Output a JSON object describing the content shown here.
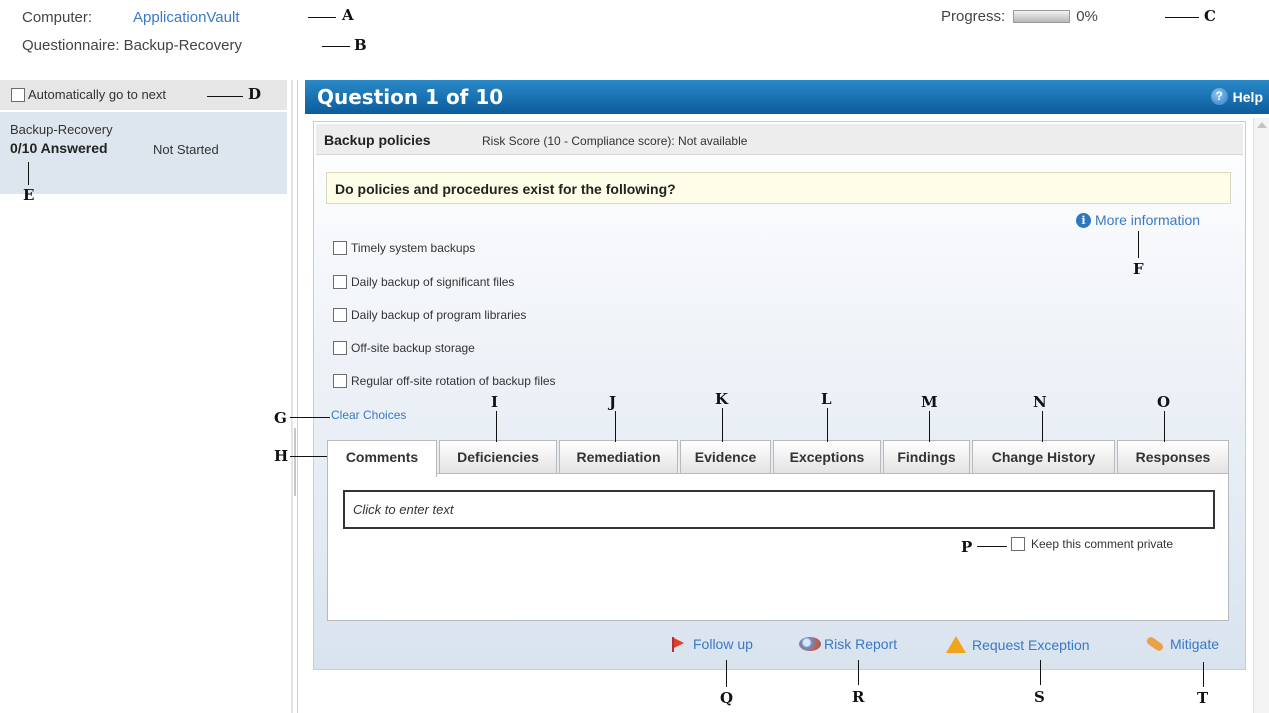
{
  "header": {
    "computer_label": "Computer:",
    "computer_value": "ApplicationVault",
    "questionnaire_label": "Questionnaire:",
    "questionnaire_value": "Backup-Recovery",
    "progress_label": "Progress:",
    "progress_value": "0%"
  },
  "sidebar": {
    "auto_next_label": "Automatically go to next",
    "item": {
      "name": "Backup-Recovery",
      "answered": "0/10 Answered",
      "status": "Not Started"
    }
  },
  "question_panel": {
    "title": "Question 1 of 10",
    "help_label": "Help",
    "topic": "Backup policies",
    "risk_score": "Risk Score (10 - Compliance score): Not available",
    "question_text": "Do policies and procedures exist for the following?",
    "more_info_label": "More information",
    "choices": [
      "Timely system backups",
      "Daily backup of significant files",
      "Daily backup of program libraries",
      "Off-site backup storage",
      "Regular off-site rotation of backup files"
    ],
    "clear_choices_label": "Clear Choices",
    "tabs": [
      "Comments",
      "Deficiencies",
      "Remediation",
      "Evidence",
      "Exceptions",
      "Findings",
      "Change History",
      "Responses"
    ],
    "active_tab": "Comments",
    "comment_placeholder": "Click to enter text",
    "private_label": "Keep this comment private",
    "actions": {
      "follow_up": "Follow up",
      "risk_report": "Risk Report",
      "request_exception": "Request Exception",
      "mitigate": "Mitigate"
    }
  },
  "callouts": [
    "A",
    "B",
    "C",
    "D",
    "E",
    "F",
    "G",
    "H",
    "I",
    "J",
    "K",
    "L",
    "M",
    "N",
    "O",
    "P",
    "Q",
    "R",
    "S",
    "T"
  ],
  "colors": {
    "link": "#3a78c9",
    "header_bar": "#1570b1",
    "question_bg": "#fdfde8"
  }
}
